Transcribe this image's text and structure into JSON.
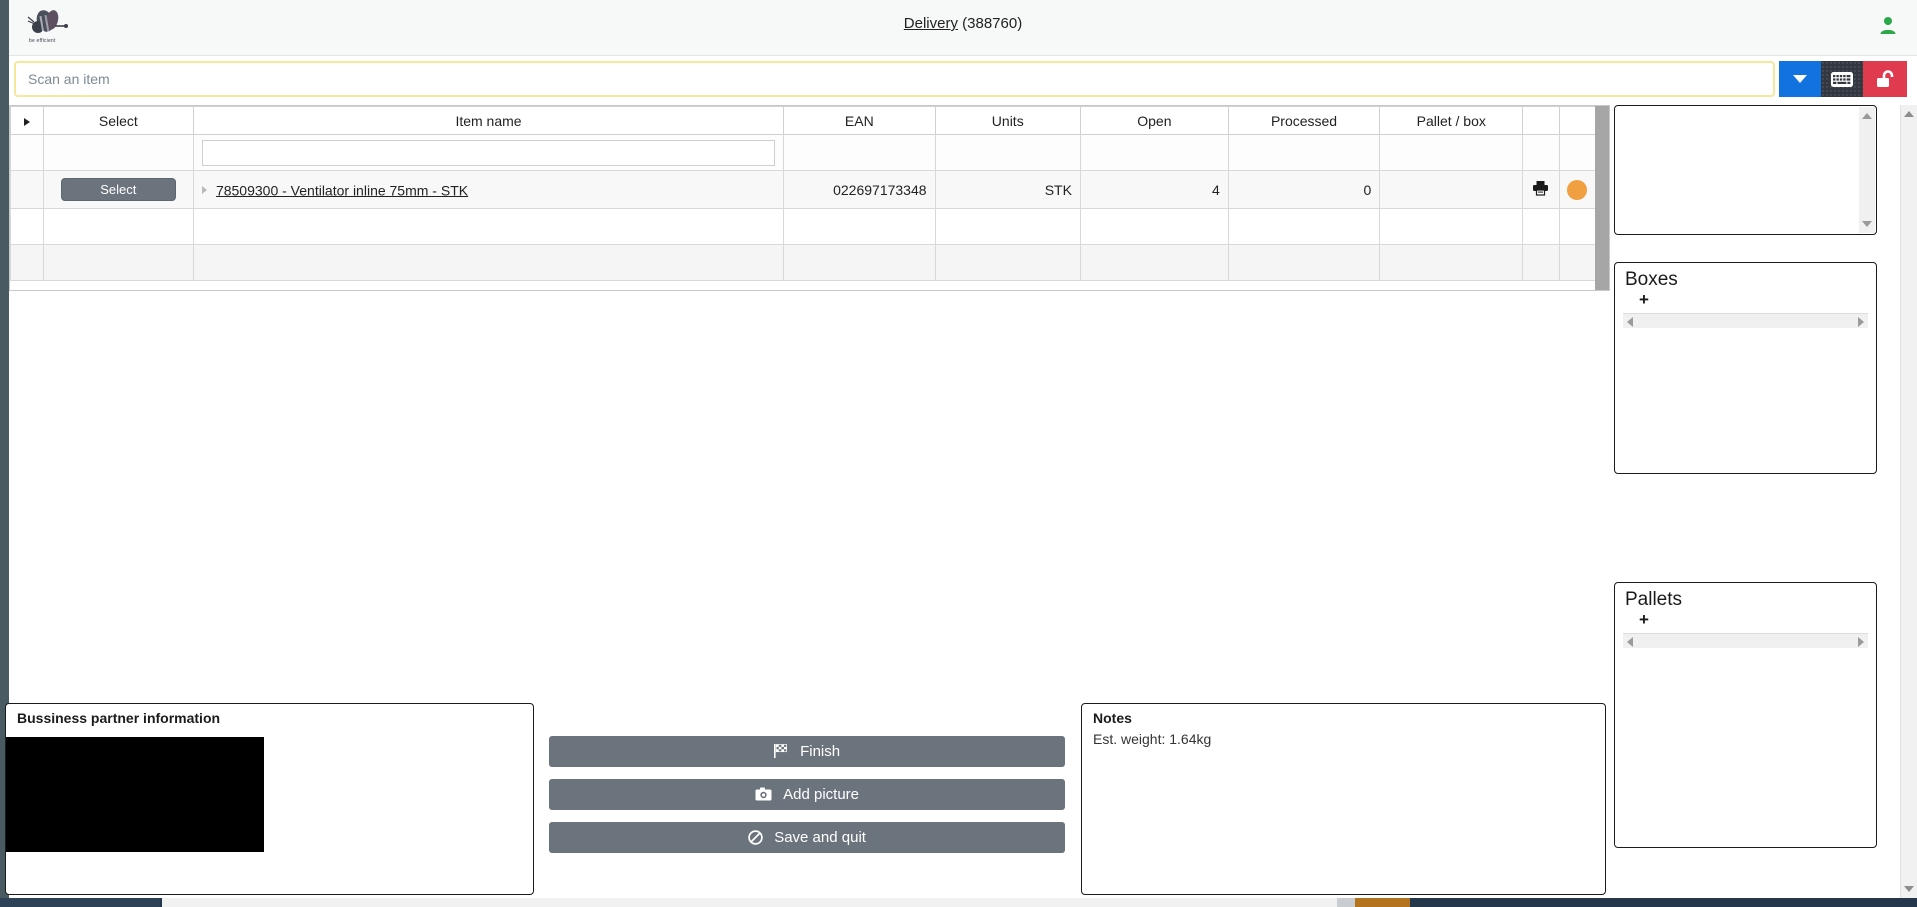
{
  "header": {
    "title_link": "Delivery",
    "title_rest": " (388760)",
    "logo_tagline": "be efficient",
    "user_icon": "user-icon"
  },
  "scanbar": {
    "input_value": "",
    "placeholder": "Scan an item",
    "dropdown_icon": "chevron-down-icon",
    "keyboard_icon": "keyboard-icon",
    "lock_icon": "unlock-icon",
    "colors": {
      "dropdown": "#1273e0",
      "keyboard": "#333840",
      "lock": "#e03a4e",
      "input_border": "#f5e79e"
    }
  },
  "table": {
    "columns": [
      "",
      "Select",
      "Item name",
      "EAN",
      "Units",
      "Open",
      "Processed",
      "Pallet / box",
      "",
      ""
    ],
    "filter_value": "",
    "rows": [
      {
        "select_label": "Select",
        "item_name": "78509300 - Ventilator inline 75mm - STK",
        "ean": "022697173348",
        "units": "STK",
        "open": "4",
        "processed": "0",
        "pallet_box": "",
        "print_icon": "printer-icon",
        "status_color": "#f0a040"
      }
    ]
  },
  "side_panels": {
    "scroll_panel": {
      "content": ""
    },
    "boxes": {
      "title": "Boxes",
      "add_label": "+",
      "items": []
    },
    "pallets": {
      "title": "Pallets",
      "add_label": "+",
      "items": []
    }
  },
  "business_partner": {
    "title": "Bussiness partner information",
    "content": ""
  },
  "actions": [
    {
      "label": "Finish",
      "icon": "checkered-flag-icon",
      "glyph": "⚑"
    },
    {
      "label": "Add picture",
      "icon": "camera-icon",
      "glyph": "▣"
    },
    {
      "label": "Save and quit",
      "icon": "no-entry-icon",
      "glyph": "⊘"
    }
  ],
  "notes": {
    "title": "Notes",
    "body": "Est. weight: 1.64kg"
  }
}
